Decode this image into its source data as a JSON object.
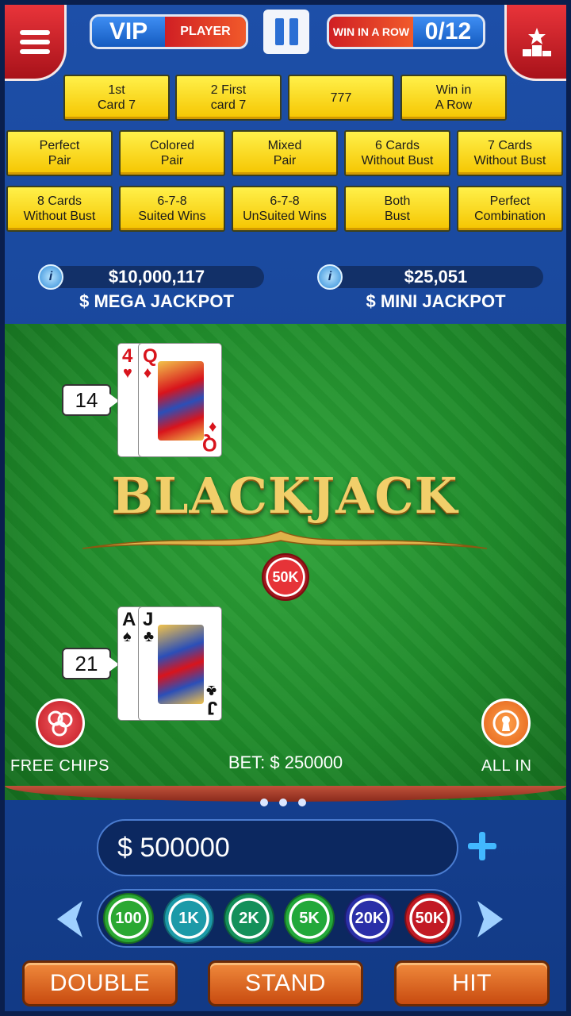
{
  "header": {
    "vip_label": "VIP",
    "player_label": "PLAYER",
    "win_label": "WIN IN A ROW",
    "win_count": "0/12"
  },
  "side_bets": [
    [
      "1st\nCard 7",
      "2 First\ncard 7",
      "777",
      "Win in\nA Row"
    ],
    [
      "Perfect\nPair",
      "Colored\nPair",
      "Mixed\nPair",
      "6 Cards\nWithout Bust",
      "7 Cards\nWithout Bust"
    ],
    [
      "8 Cards\nWithout Bust",
      "6-7-8\nSuited Wins",
      "6-7-8\nUnSuited Wins",
      "Both\nBust",
      "Perfect\nCombination"
    ]
  ],
  "jackpots": {
    "mega": {
      "amount": "$10,000,117",
      "title": "$ MEGA JACKPOT"
    },
    "mini": {
      "amount": "$25,051",
      "title": "$ MINI JACKPOT"
    }
  },
  "dealer": {
    "score": "14",
    "cards": [
      {
        "rank": "4",
        "suit": "♥",
        "color": "red"
      },
      {
        "rank": "Q",
        "suit": "♦",
        "color": "red"
      }
    ]
  },
  "player": {
    "score": "21",
    "cards": [
      {
        "rank": "A",
        "suit": "♠",
        "color": "black"
      },
      {
        "rank": "J",
        "suit": "♣",
        "color": "black"
      }
    ]
  },
  "table": {
    "logo": "BLACKJACK",
    "bet_chip": "50K",
    "bet_text": "BET: $ 250000",
    "free_chips_label": "FREE CHIPS",
    "all_in_label": "ALL IN"
  },
  "balance": "$ 500000",
  "chips": [
    {
      "label": "100",
      "color": "#2aa832"
    },
    {
      "label": "1K",
      "color": "#1c9aa8"
    },
    {
      "label": "2K",
      "color": "#14905a"
    },
    {
      "label": "5K",
      "color": "#22a83a"
    },
    {
      "label": "20K",
      "color": "#2a2fa8"
    },
    {
      "label": "50K",
      "color": "#c21a24"
    }
  ],
  "actions": {
    "double": "DOUBLE",
    "stand": "STAND",
    "hit": "HIT"
  },
  "colors": {
    "accent_gold": "#f5c500",
    "felt_green": "#1f8a2a",
    "button_orange": "#e06a22",
    "header_red": "#d01f24"
  }
}
